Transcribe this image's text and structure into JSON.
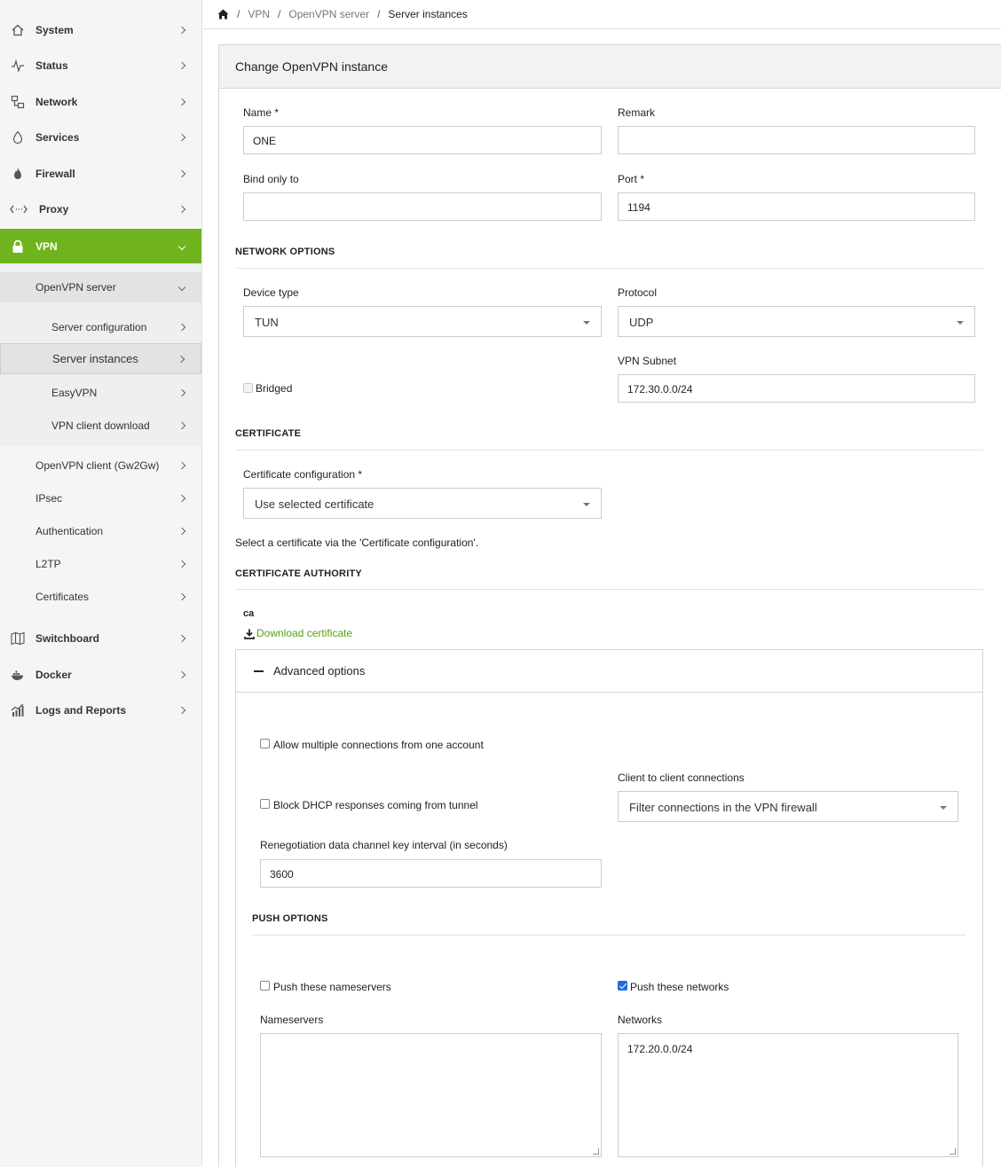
{
  "sidebar": {
    "items": [
      {
        "label": "System",
        "icon": "home-icon"
      },
      {
        "label": "Status",
        "icon": "pulse-icon"
      },
      {
        "label": "Network",
        "icon": "network-icon"
      },
      {
        "label": "Services",
        "icon": "drop-icon"
      },
      {
        "label": "Firewall",
        "icon": "flame-icon"
      },
      {
        "label": "Proxy",
        "icon": "arrows-icon"
      },
      {
        "label": "VPN",
        "icon": "lock-icon"
      },
      {
        "label": "Switchboard",
        "icon": "map-icon"
      },
      {
        "label": "Docker",
        "icon": "docker-icon"
      },
      {
        "label": "Logs and Reports",
        "icon": "chart-icon"
      }
    ],
    "vpn_sub": {
      "openvpn_server": "OpenVPN server",
      "server_children": [
        "Server configuration",
        "Server instances",
        "EasyVPN",
        "VPN client download"
      ],
      "others": [
        "OpenVPN client (Gw2Gw)",
        "IPsec",
        "Authentication",
        "L2TP",
        "Certificates"
      ]
    }
  },
  "breadcrumb": {
    "items": [
      "VPN",
      "OpenVPN server",
      "Server instances"
    ]
  },
  "panel": {
    "title": "Change OpenVPN instance"
  },
  "form": {
    "name_label": "Name *",
    "name_value": "ONE",
    "remark_label": "Remark",
    "remark_value": "",
    "bind_label": "Bind only to",
    "bind_value": "",
    "port_label": "Port *",
    "port_value": "1194",
    "network_options": "NETWORK OPTIONS",
    "device_type_label": "Device type",
    "device_type_value": "TUN",
    "protocol_label": "Protocol",
    "protocol_value": "UDP",
    "bridged_label": "Bridged",
    "vpn_subnet_label": "VPN Subnet",
    "vpn_subnet_value": "172.30.0.0/24",
    "certificate": "CERTIFICATE",
    "cert_config_label": "Certificate configuration *",
    "cert_config_value": "Use selected certificate",
    "cert_hint": "Select a certificate via the 'Certificate configuration'.",
    "certificate_authority": "CERTIFICATE AUTHORITY",
    "ca_name": "ca",
    "download_label": "Download certificate",
    "advanced_label": "Advanced options",
    "allow_multi_label": "Allow multiple connections from one account",
    "c2c_label": "Client to client connections",
    "c2c_value": "Filter connections in the VPN firewall",
    "block_dhcp_label": "Block DHCP responses coming from tunnel",
    "reneg_label": "Renegotiation data channel key interval (in seconds)",
    "reneg_value": "3600",
    "push_options": "PUSH OPTIONS",
    "push_ns_label": "Push these nameservers",
    "push_nets_label": "Push these networks",
    "nameservers_label": "Nameservers",
    "nameservers_value": "",
    "networks_label": "Networks",
    "networks_value": "172.20.0.0/24"
  },
  "colors": {
    "accent": "#6fb41e",
    "link": "#5a9e12",
    "checkbox_checked": "#1d6ed8"
  }
}
